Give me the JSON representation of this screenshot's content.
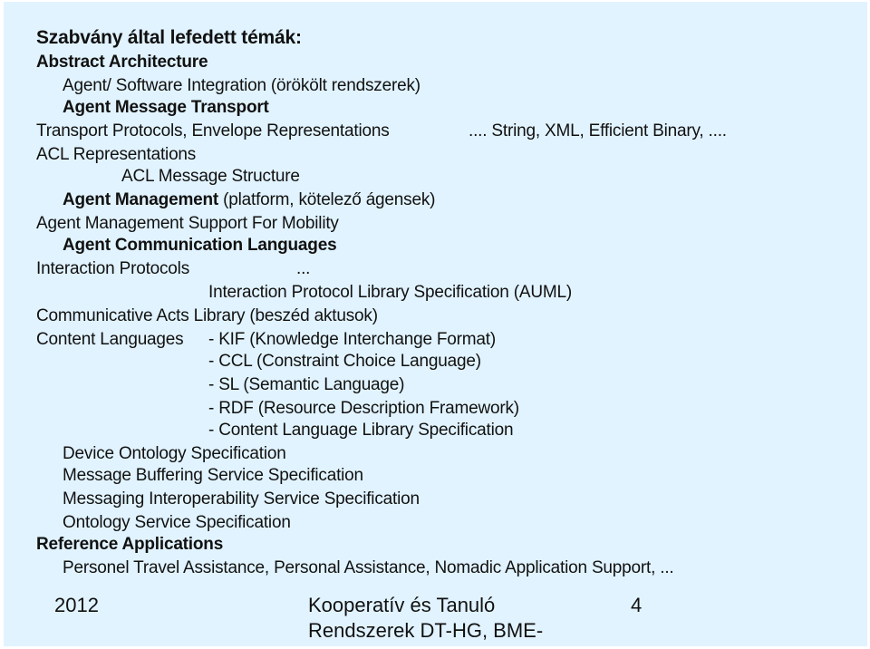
{
  "slide": {
    "title": "Szabvány által lefedett témák:",
    "lines": [
      {
        "text": "Abstract Architecture"
      },
      {
        "text": "Agent/ Software Integration (örökölt rendszerek)"
      },
      {
        "text": "Agent Message Transport"
      },
      {
        "text": "Transport Protocols, Envelope Representations",
        "extra": ".... String, XML, Efficient Binary, ...."
      },
      {
        "text": "ACL Representations"
      },
      {
        "text": "ACL Message Structure"
      },
      {
        "text": "Agent Management",
        "suffix": " (platform, kötelező ágensek)"
      },
      {
        "text": "Agent Management Support For Mobility"
      },
      {
        "text": "Agent Communication Languages"
      },
      {
        "text": "Interaction Protocols",
        "extra": "..."
      },
      {
        "text": "Interaction Protocol Library Specification (AUML)"
      },
      {
        "text": "Communicative Acts Library (beszéd aktusok)"
      },
      {
        "text": "Content Languages",
        "extra": "- KIF (Knowledge Interchange Format)"
      },
      {
        "text": "- CCL (Constraint Choice Language)"
      },
      {
        "text": "- SL (Semantic Language)"
      },
      {
        "text": "- RDF (Resource Description Framework)"
      },
      {
        "text": "- Content Language Library Specification"
      },
      {
        "text": "Device Ontology Specification"
      },
      {
        "text": "Message Buffering Service Specification"
      },
      {
        "text": "Messaging Interoperability Service Specification"
      },
      {
        "text": "Ontology Service Specification"
      },
      {
        "text": "Reference Applications"
      },
      {
        "text": "Personel Travel Assistance, Personal Assistance, Nomadic Application Support, ..."
      }
    ]
  },
  "footer": {
    "year": "2012",
    "course_line1": "Kooperatív és Tanuló",
    "course_line2": "Rendszerek DT-HG, BME-",
    "page_number": "4"
  }
}
